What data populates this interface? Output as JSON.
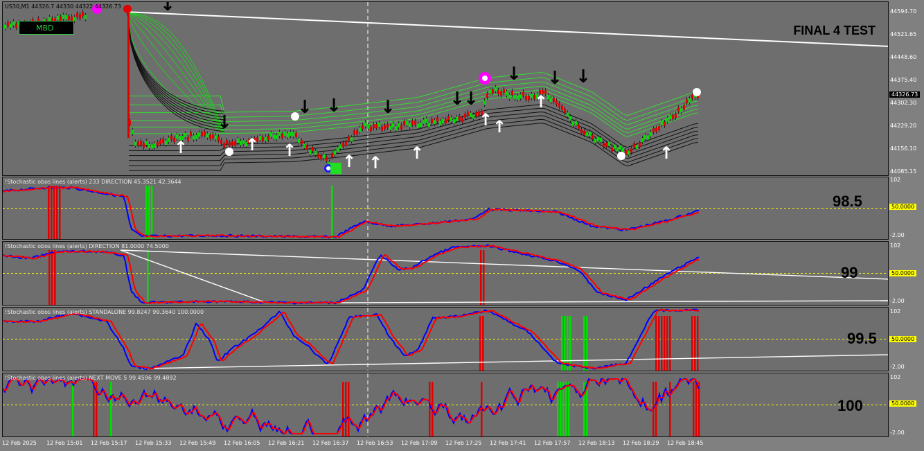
{
  "chart": {
    "symbol_label": "US30,M1  44326.7  44330  44322  44326.73",
    "annotation": "FINAL 4 TEST",
    "mbd_label": "MBD"
  },
  "price_axis": {
    "ticks": [
      "44594.70",
      "44521.65",
      "44448.60",
      "44375.40",
      "44302.30",
      "44229.20",
      "44156.10",
      "44085.15"
    ],
    "current_price": "44326.73",
    "current_price_color": "#ffffff"
  },
  "indicators": [
    {
      "label": "!Stochastic obos lines (alerts) 233 DIRECTION 45.3521 42.3644",
      "big_value": "98.5",
      "axis_top": "102",
      "axis_mid": "50.0000",
      "axis_bottom": "-2.00"
    },
    {
      "label": "!Stochastic obos lines (alerts) DIRECTION 81.0000 74.5000",
      "big_value": "99",
      "axis_top": "102",
      "axis_mid": "50.0000",
      "axis_bottom": "-2.00"
    },
    {
      "label": "!Stochastic obos lines (alerts) STANDALONE 99.8247 99.3640 100.0000",
      "big_value": "99.5",
      "axis_top": "102",
      "axis_mid": "50.0000",
      "axis_bottom": "-2.00"
    },
    {
      "label": "!Stochastic obos lines (alerts) NEXT MOVE 5 99.4596 99.4892",
      "big_value": "100",
      "axis_top": "102",
      "axis_mid": "50.0000",
      "axis_bottom": "-2.00"
    }
  ],
  "time_axis": [
    "12 Feb 2025",
    "12 Feb 15:01",
    "12 Feb 15:17",
    "12 Feb 15:33",
    "12 Feb 15:49",
    "12 Feb 16:05",
    "12 Feb 16:21",
    "12 Feb 16:37",
    "12 Feb 16:53",
    "12 Feb 17:09",
    "12 Feb 17:25",
    "12 Feb 17:41",
    "12 Feb 17:57",
    "12 Feb 18:13",
    "12 Feb 18:29",
    "12 Feb 18:45"
  ],
  "colors": {
    "bull": "#00e000",
    "bear": "#e00000",
    "stoch_main": "#0000ff",
    "stoch_signal": "#ff0000",
    "level": "#ffff00",
    "trendline": "#ffffff"
  }
}
